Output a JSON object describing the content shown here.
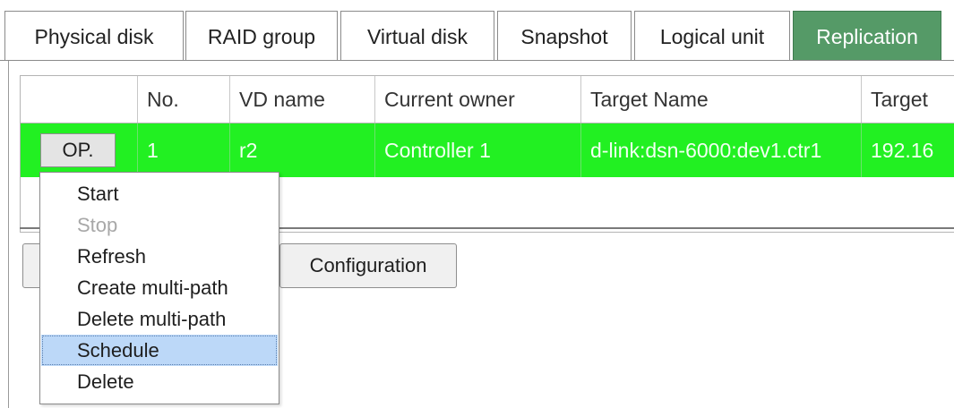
{
  "tabs": [
    {
      "label": "Physical disk"
    },
    {
      "label": "RAID group"
    },
    {
      "label": "Virtual disk"
    },
    {
      "label": "Snapshot"
    },
    {
      "label": "Logical unit"
    },
    {
      "label": "Replication",
      "active": true
    }
  ],
  "table": {
    "columns": [
      "",
      "No.",
      "VD name",
      "Current owner",
      "Target Name",
      "Target"
    ],
    "rows": [
      {
        "op": "OP.",
        "no": "1",
        "vd_name": "r2",
        "current_owner": "Controller 1",
        "target_name": "d-link:dsn-6000:dev1.ctr1",
        "target": "192.16"
      }
    ],
    "row_color": "#22f022"
  },
  "buttons": {
    "configuration": "Configuration"
  },
  "menu": {
    "items": [
      {
        "label": "Start"
      },
      {
        "label": "Stop",
        "disabled": true
      },
      {
        "label": "Refresh"
      },
      {
        "label": "Create multi-path"
      },
      {
        "label": "Delete multi-path"
      },
      {
        "label": "Schedule",
        "highlighted": true
      },
      {
        "label": "Delete"
      }
    ]
  },
  "colors": {
    "active_tab": "#559a67",
    "highlight": "#bcd8f8"
  }
}
